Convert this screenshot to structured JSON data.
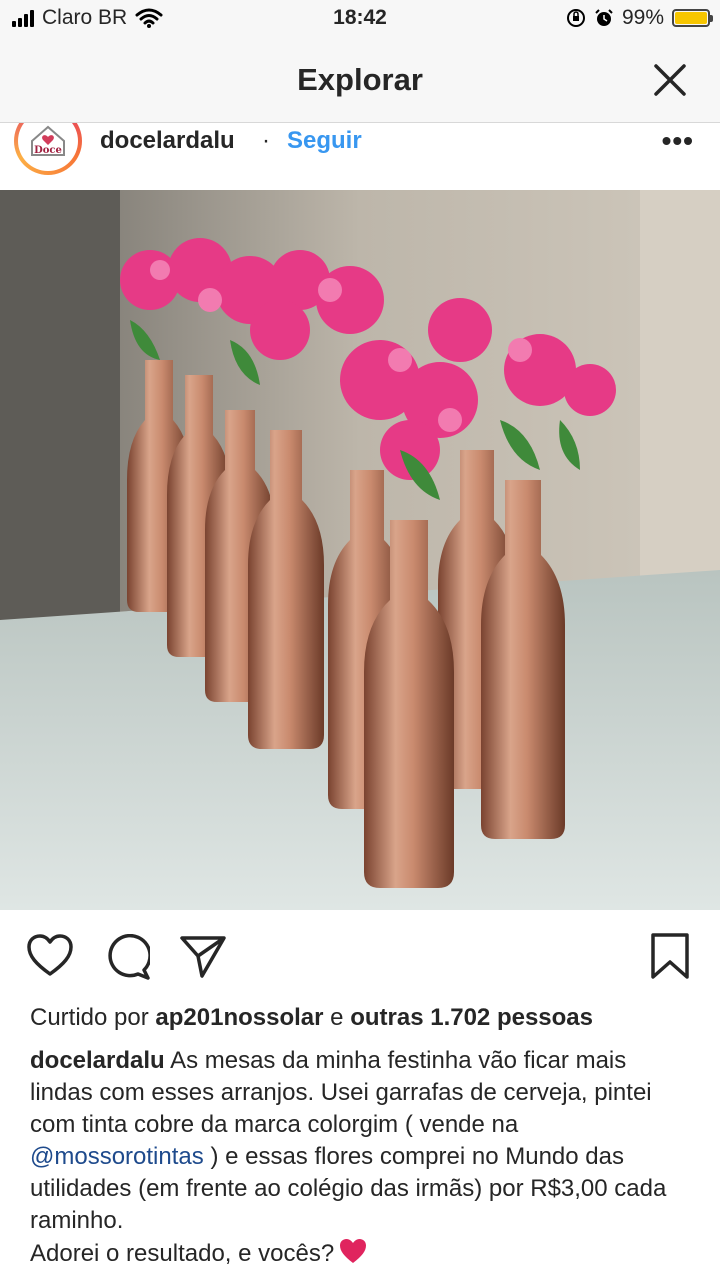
{
  "status_bar": {
    "carrier": "Claro BR",
    "time": "18:42",
    "battery": "99%",
    "battery_color": "#f7c600"
  },
  "nav": {
    "title": "Explorar",
    "close_icon": "close-icon"
  },
  "post": {
    "username": "docelardalu",
    "separator": "·",
    "follow_label": "Seguir",
    "more_icon": "more-icon",
    "avatar_text": "Doce",
    "likes": {
      "prefix": "Curtido por",
      "liker": "ap201nossolar",
      "connector": "e",
      "others": "outras 1.702 pessoas"
    },
    "caption": {
      "user": "docelardalu",
      "text_before_mention": "As mesas da minha festinha vão ficar mais lindas com esses arranjos. Usei garrafas de cerveja, pintei com tinta cobre da marca colorgim ( vende na",
      "mention": "@mossorotintas",
      "text_after_mention": ") e essas flores comprei no Mundo das utilidades (em frente ao colégio das irmãs) por R$3,00 cada raminho.",
      "closing": "Adorei o resultado, e vocês?"
    }
  },
  "colors": {
    "link_blue": "#3897f0",
    "mention_blue": "#1e4a8c",
    "heart_red": "#e0245e"
  }
}
